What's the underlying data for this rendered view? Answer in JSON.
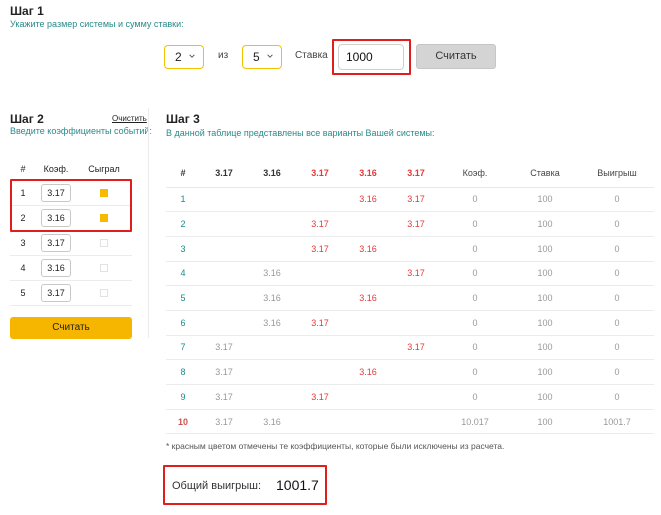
{
  "step1": {
    "title": "Шаг 1",
    "subtitle": "Укажите размер системы и сумму ставки:",
    "system_k": "2",
    "of_label": "из",
    "system_n": "5",
    "stake_label": "Ставка",
    "stake_value": "1000",
    "calc_button": "Считать"
  },
  "step2": {
    "title": "Шаг 2",
    "clear_link": "Очистить",
    "subtitle": "Введите коэффициенты событий:",
    "headers": {
      "num": "#",
      "coef": "Коэф.",
      "played": "Сыграл"
    },
    "rows": [
      {
        "num": "1",
        "coef": "3.17",
        "played": true
      },
      {
        "num": "2",
        "coef": "3.16",
        "played": true
      },
      {
        "num": "3",
        "coef": "3.17",
        "played": false
      },
      {
        "num": "4",
        "coef": "3.16",
        "played": false
      },
      {
        "num": "5",
        "coef": "3.17",
        "played": false
      }
    ],
    "calc_button": "Считать"
  },
  "step3": {
    "title": "Шаг 3",
    "subtitle": "В данной таблице представлены все варианты Вашей системы:",
    "headers": [
      "#",
      "3.17",
      "3.16",
      "3.17",
      "3.16",
      "3.17",
      "Коэф.",
      "Ставка",
      "Выигрыш"
    ],
    "rows": [
      [
        "1",
        "",
        "",
        "",
        "3.16",
        "3.17",
        "0",
        "100",
        "0"
      ],
      [
        "2",
        "",
        "",
        "3.17",
        "",
        "3.17",
        "0",
        "100",
        "0"
      ],
      [
        "3",
        "",
        "",
        "3.17",
        "3.16",
        "",
        "0",
        "100",
        "0"
      ],
      [
        "4",
        "",
        "3.16",
        "",
        "",
        "3.17",
        "0",
        "100",
        "0"
      ],
      [
        "5",
        "",
        "3.16",
        "",
        "3.16",
        "",
        "0",
        "100",
        "0"
      ],
      [
        "6",
        "",
        "3.16",
        "3.17",
        "",
        "",
        "0",
        "100",
        "0"
      ],
      [
        "7",
        "3.17",
        "",
        "",
        "",
        "3.17",
        "0",
        "100",
        "0"
      ],
      [
        "8",
        "3.17",
        "",
        "",
        "3.16",
        "",
        "0",
        "100",
        "0"
      ],
      [
        "9",
        "3.17",
        "",
        "3.17",
        "",
        "",
        "0",
        "100",
        "0"
      ],
      [
        "10",
        "3.17",
        "3.16",
        "",
        "",
        "",
        "10.017",
        "100",
        "1001.7"
      ]
    ],
    "footnote": "* красным цветом отмечены те коэффициенты, которые были исключены из расчета.",
    "total_label": "Общий выигрыш:",
    "total_value": "1001.7"
  },
  "colors": {
    "accent_yellow": "#f6b600",
    "excluded_red": "#e23b3b",
    "teal": "#2a8a8a",
    "highlight_frame": "#e01e1e"
  }
}
